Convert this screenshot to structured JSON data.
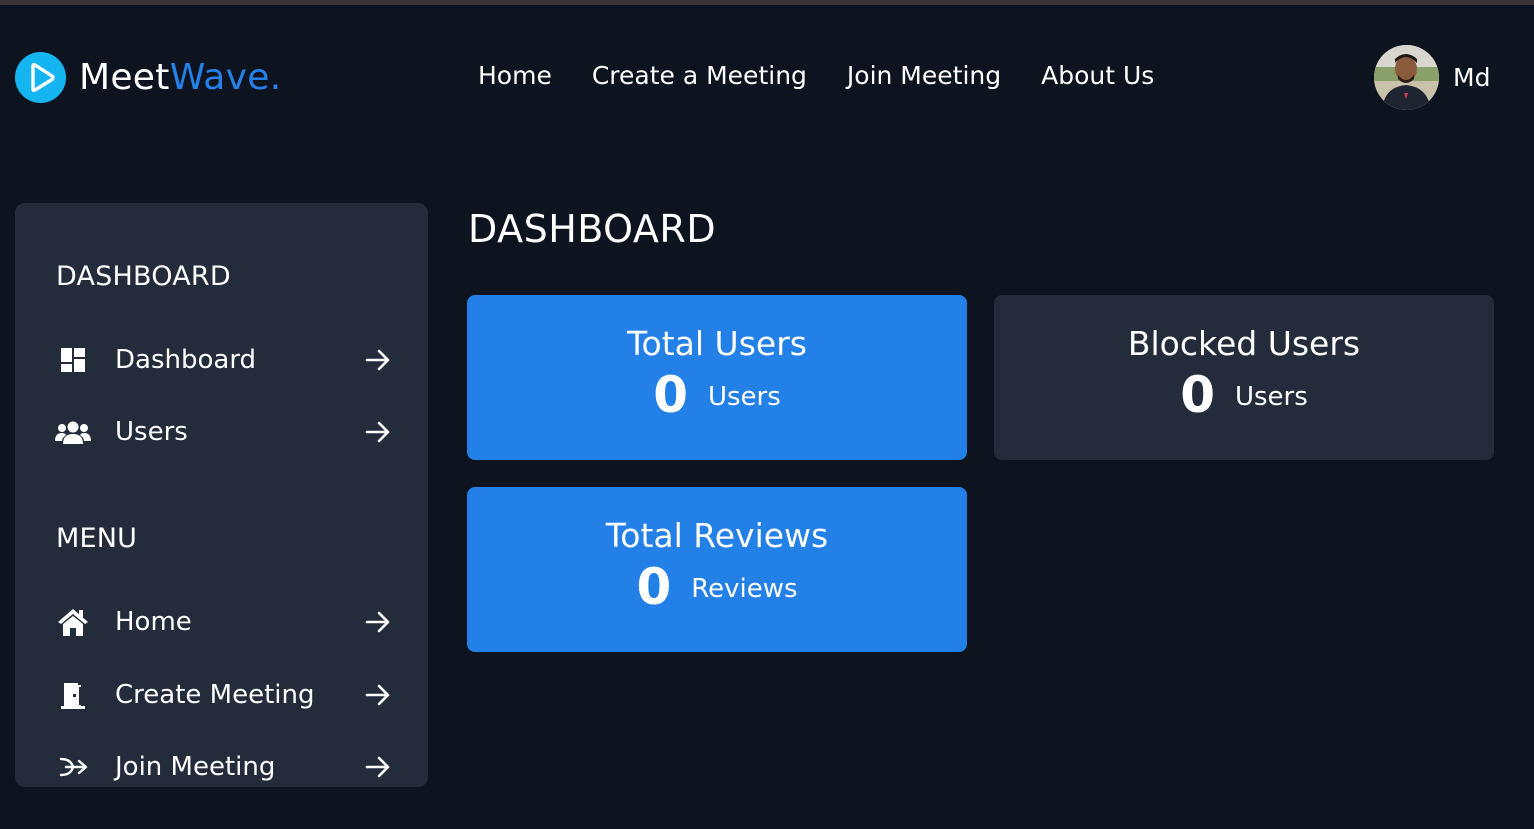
{
  "brand": {
    "name_part1": "Meet",
    "name_part2": "Wave."
  },
  "nav": {
    "links": [
      "Home",
      "Create a Meeting",
      "Join Meeting",
      "About Us"
    ],
    "user_name": "Md"
  },
  "sidebar": {
    "dashboard_heading": "DASHBOARD",
    "dashboard_items": [
      {
        "label": "Dashboard",
        "icon": "dashboard-grid-icon"
      },
      {
        "label": "Users",
        "icon": "users-group-icon"
      }
    ],
    "menu_heading": "MENU",
    "menu_items": [
      {
        "label": "Home",
        "icon": "home-icon"
      },
      {
        "label": "Create Meeting",
        "icon": "door-icon"
      },
      {
        "label": "Join Meeting",
        "icon": "sign-in-icon"
      }
    ]
  },
  "main": {
    "title": "DASHBOARD",
    "cards": [
      {
        "title": "Total Users",
        "value": "0",
        "unit": "Users"
      },
      {
        "title": "Blocked Users",
        "value": "0",
        "unit": "Users"
      },
      {
        "title": "Total Reviews",
        "value": "0",
        "unit": "Reviews"
      }
    ]
  },
  "colors": {
    "background": "#0d131f",
    "panel": "#242c3b",
    "accent_blue": "#2280e6",
    "logo_cyan": "#14b5f0"
  }
}
